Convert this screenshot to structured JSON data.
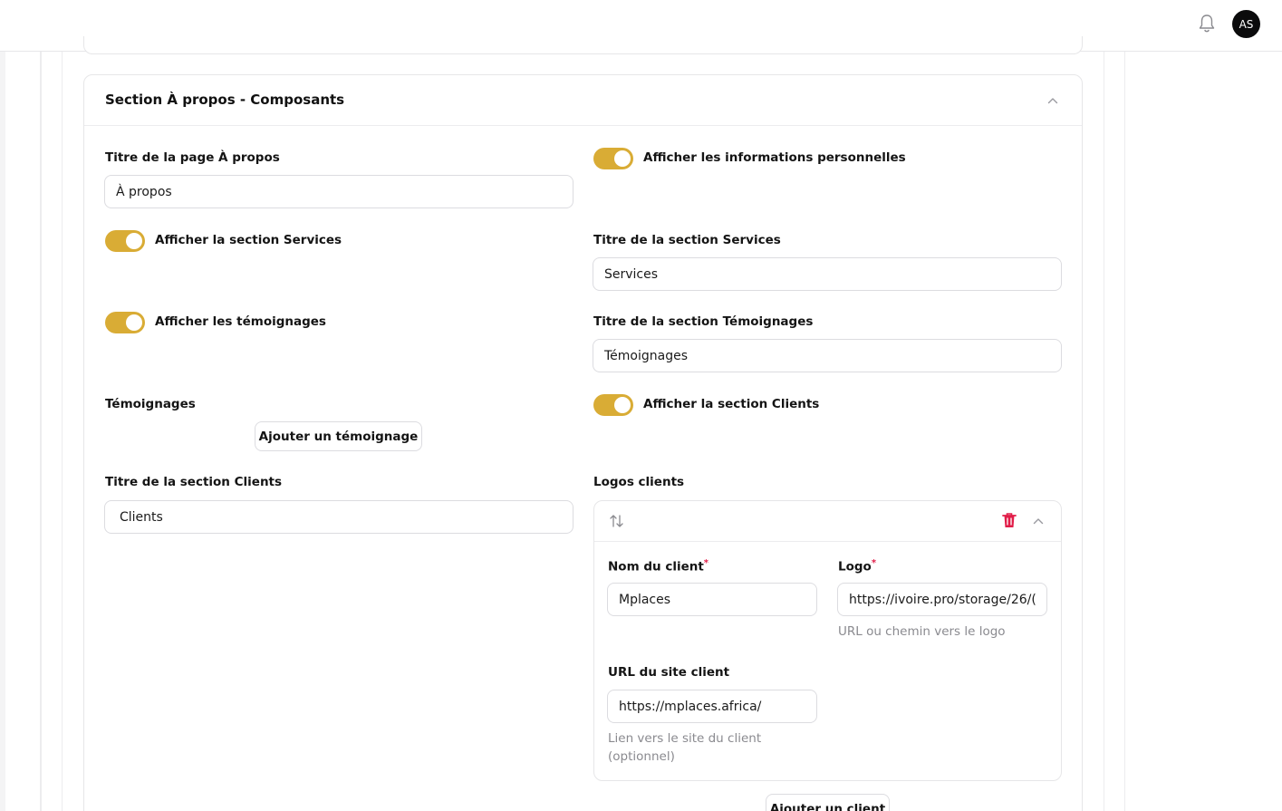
{
  "header": {
    "avatar_initials": "AS",
    "bell_icon": "bell-icon"
  },
  "section": {
    "title": "Section À propos - Composants",
    "about_title_label": "Titre de la page À propos",
    "about_title_value": "À propos",
    "show_personal_info_label": "Afficher les informations personnelles",
    "show_services_label": "Afficher la section Services",
    "services_title_label": "Titre de la section Services",
    "services_title_value": "Services",
    "show_testimonials_label": "Afficher les témoignages",
    "testimonials_title_label": "Titre de la section Témoignages",
    "testimonials_title_value": "Témoignages",
    "testimonials_label": "Témoignages",
    "add_testimonial_button": "Ajouter un témoignage",
    "show_clients_label": "Afficher la section Clients",
    "clients_title_label": "Titre de la section Clients",
    "clients_title_value": "Clients",
    "client_logos_label": "Logos clients",
    "add_client_button": "Ajouter un client"
  },
  "client_item": {
    "name_label": "Nom du client",
    "name_value": "Mplaces",
    "logo_label": "Logo",
    "logo_value": "https://ivoire.pro/storage/26/(",
    "logo_hint": "URL ou chemin vers le logo",
    "url_label": "URL du site client",
    "url_value": "https://mplaces.africa/",
    "url_hint": "Lien vers le site du client (optionnel)",
    "required_mark": "*"
  },
  "colors": {
    "toggle_on": "#d9ac35",
    "delete": "#e11d48"
  }
}
